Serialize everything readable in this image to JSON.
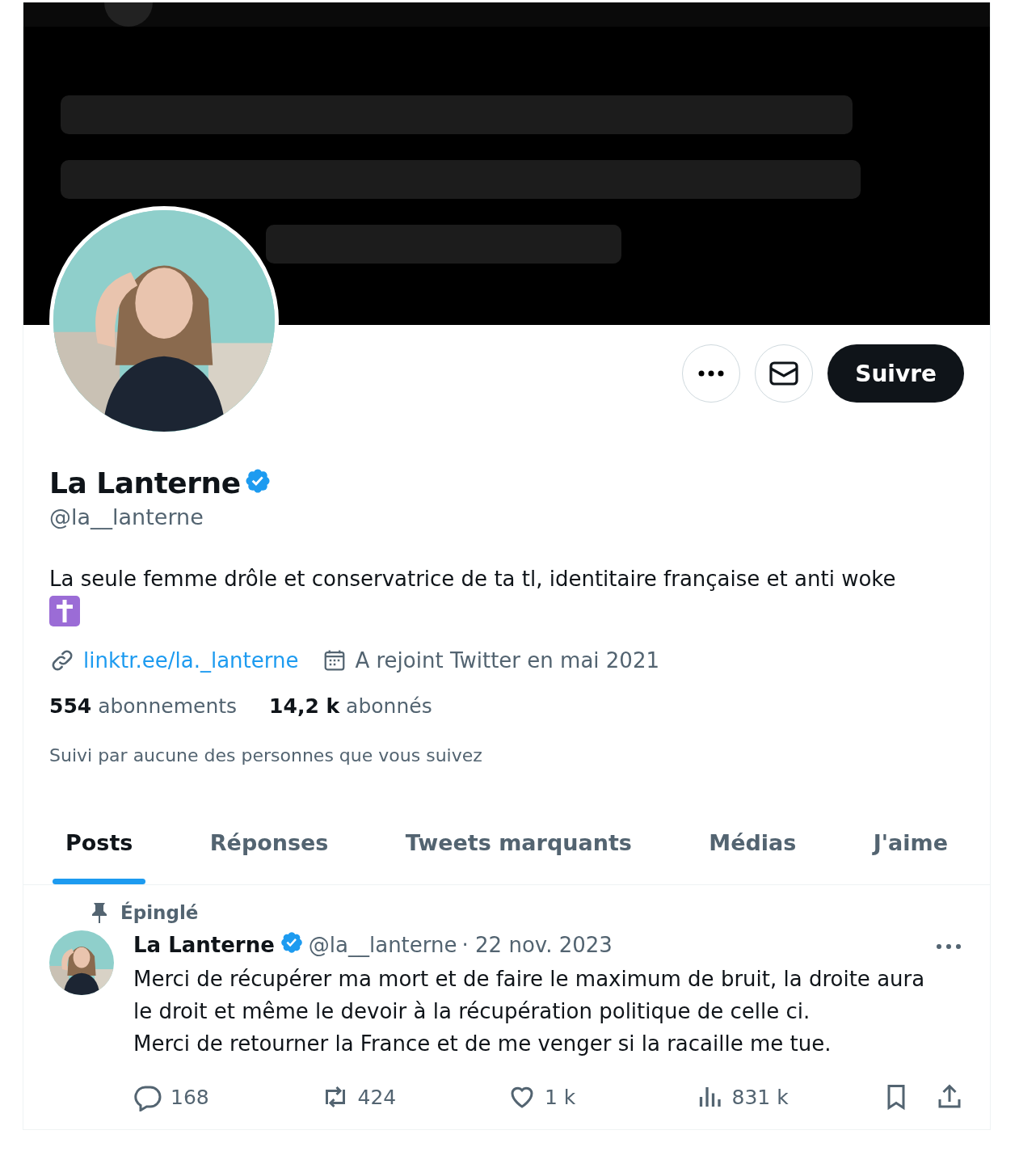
{
  "profile": {
    "name": "La Lanterne",
    "verified": true,
    "handle": "@la__lanterne",
    "bio": "La seule femme drôle et conservatrice de ta tl, identitaire française et anti woke",
    "link": "linktr.ee/la._lanterne",
    "joined": "A rejoint Twitter en mai 2021",
    "following_count": "554",
    "following_label": "abonnements",
    "followers_count": "14,2 k",
    "followers_label": "abonnés",
    "followed_by": "Suivi par aucune des personnes que vous suivez",
    "follow_button": "Suivre"
  },
  "tabs": [
    {
      "label": "Posts",
      "selected": true
    },
    {
      "label": "Réponses",
      "selected": false
    },
    {
      "label": "Tweets marquants",
      "selected": false
    },
    {
      "label": "Médias",
      "selected": false
    },
    {
      "label": "J'aime",
      "selected": false
    }
  ],
  "tweet": {
    "pinned_label": "Épinglé",
    "name": "La Lanterne",
    "verified": true,
    "handle": "@la__lanterne",
    "date": "· 22 nov. 2023",
    "lines": [
      "Merci de récupérer ma mort et de faire le maximum de bruit, la droite aura le droit et même le devoir à la récupération politique de celle ci.",
      "Merci de retourner la France et de me venger si la racaille me tue."
    ],
    "actions": [
      {
        "kind": "reply",
        "count": "168"
      },
      {
        "kind": "retweet",
        "count": "424"
      },
      {
        "kind": "like",
        "count": "1 k"
      },
      {
        "kind": "views",
        "count": "831 k"
      },
      {
        "kind": "bookmark"
      },
      {
        "kind": "share"
      }
    ]
  }
}
